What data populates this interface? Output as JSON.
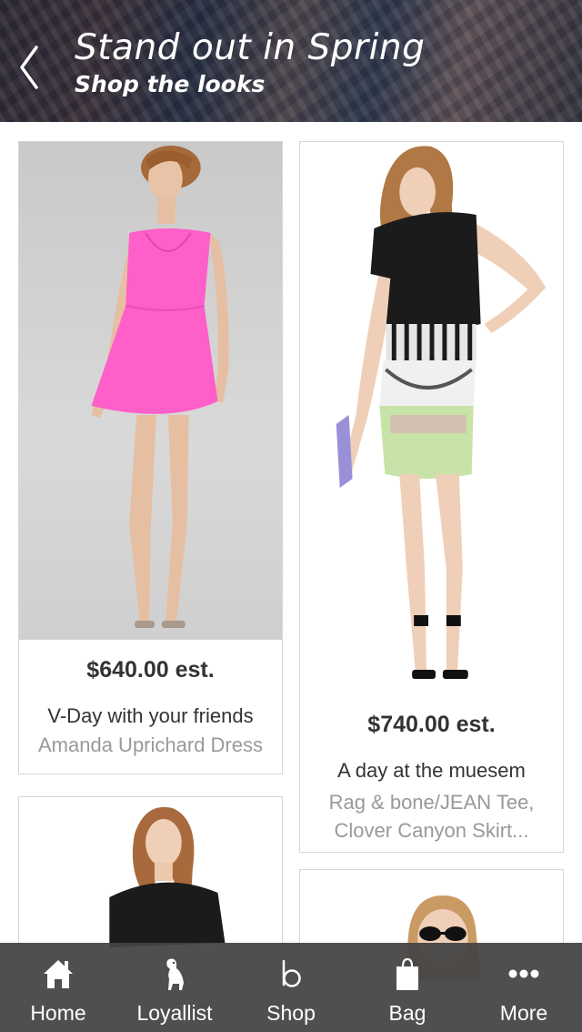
{
  "header": {
    "title": "Stand out in Spring",
    "subtitle": "Shop the looks"
  },
  "colors": {
    "tabbar_bg": "#444444",
    "card_border": "#d6d6d6",
    "price_text": "#333333",
    "secondary_text": "#999999",
    "dress_pink": "#ff5fc8"
  },
  "looks": [
    {
      "price": "$640.00 est.",
      "title": "V-Day with your friends",
      "items": "Amanda Uprichard Dress"
    },
    {
      "price": "$740.00 est.",
      "title": "A day at the muesem",
      "items": "Rag & bone/JEAN Tee,\nClover Canyon Skirt..."
    }
  ],
  "tabs": [
    {
      "label": "Home",
      "icon": "home-icon"
    },
    {
      "label": "Loyallist",
      "icon": "dog-icon"
    },
    {
      "label": "Shop",
      "icon": "b-logo-icon"
    },
    {
      "label": "Bag",
      "icon": "bag-icon"
    },
    {
      "label": "More",
      "icon": "more-dots-icon"
    }
  ]
}
